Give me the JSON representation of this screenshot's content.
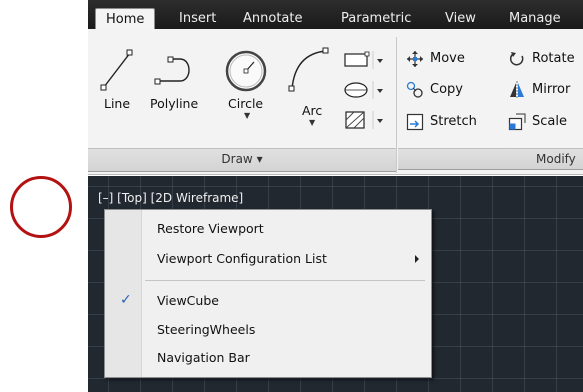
{
  "tabs": [
    "Home",
    "Insert",
    "Annotate",
    "Parametric",
    "View",
    "Manage"
  ],
  "draw_panel": {
    "tools": [
      "Line",
      "Polyline",
      "Circle",
      "Arc"
    ],
    "footer": "Draw ▾"
  },
  "modify_panel": {
    "items": [
      "Move",
      "Rotate",
      "Copy",
      "Mirror",
      "Stretch",
      "Scale"
    ],
    "footer": "Modify"
  },
  "viewport": {
    "label": "[–] [Top] [2D Wireframe]"
  },
  "context_menu": {
    "items": [
      {
        "label": "Restore Viewport"
      },
      {
        "label": "Viewport Configuration List"
      },
      {
        "label": "ViewCube",
        "checked": true
      },
      {
        "label": "SteeringWheels"
      },
      {
        "label": "Navigation Bar"
      }
    ]
  },
  "colors": {
    "annotation_circle": "#b31212",
    "viewport_bg": "#212830",
    "check_blue": "#2b62b5"
  }
}
